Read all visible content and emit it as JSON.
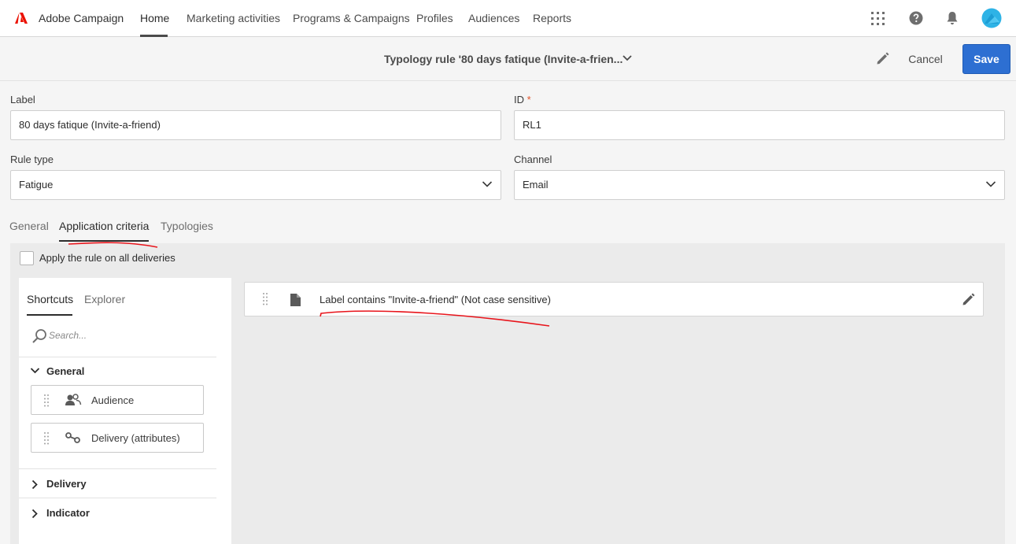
{
  "app": {
    "brand": "Adobe Campaign",
    "brand_color": "#eb1000"
  },
  "nav": {
    "items": [
      {
        "label": "Home",
        "active": true
      },
      {
        "label": "Marketing activities"
      },
      {
        "label": "Programs & Campaigns"
      },
      {
        "label": "Profiles"
      },
      {
        "label": "Audiences"
      },
      {
        "label": "Reports"
      }
    ],
    "icons": [
      "apps-grid-icon",
      "help-icon",
      "notifications-bell-icon",
      "user-avatar"
    ]
  },
  "header": {
    "title": "Typology rule '80 days fatique (Invite-a-frien...",
    "cancel_label": "Cancel",
    "save_label": "Save",
    "accent_color": "#2d6fd2"
  },
  "form": {
    "label_field": {
      "label": "Label",
      "value": "80 days fatique (Invite-a-friend)"
    },
    "id_field": {
      "label": "ID",
      "required_mark": "*",
      "value": "RL1"
    },
    "rule_type": {
      "label": "Rule type",
      "value": "Fatigue"
    },
    "channel": {
      "label": "Channel",
      "value": "Email"
    }
  },
  "tabs": [
    {
      "label": "General"
    },
    {
      "label": "Application criteria",
      "active": true
    },
    {
      "label": "Typologies"
    }
  ],
  "criteria": {
    "apply_all_label": "Apply the rule on all deliveries",
    "apply_all_checked": false,
    "left_tabs": [
      {
        "label": "Shortcuts",
        "active": true
      },
      {
        "label": "Explorer"
      }
    ],
    "search_placeholder": "Search...",
    "sections": [
      {
        "label": "General",
        "expanded": true
      },
      {
        "label": "Delivery",
        "expanded": false
      },
      {
        "label": "Indicator",
        "expanded": false
      }
    ],
    "shortcuts": [
      {
        "label": "Audience",
        "icon": "audience-icon"
      },
      {
        "label": "Delivery (attributes)",
        "icon": "delivery-attributes-icon"
      }
    ],
    "rules": [
      {
        "text": "Label contains \"Invite-a-friend\" (Not case sensitive)",
        "icon": "document-icon"
      }
    ]
  },
  "annotations": {
    "color": "#e8141b"
  }
}
